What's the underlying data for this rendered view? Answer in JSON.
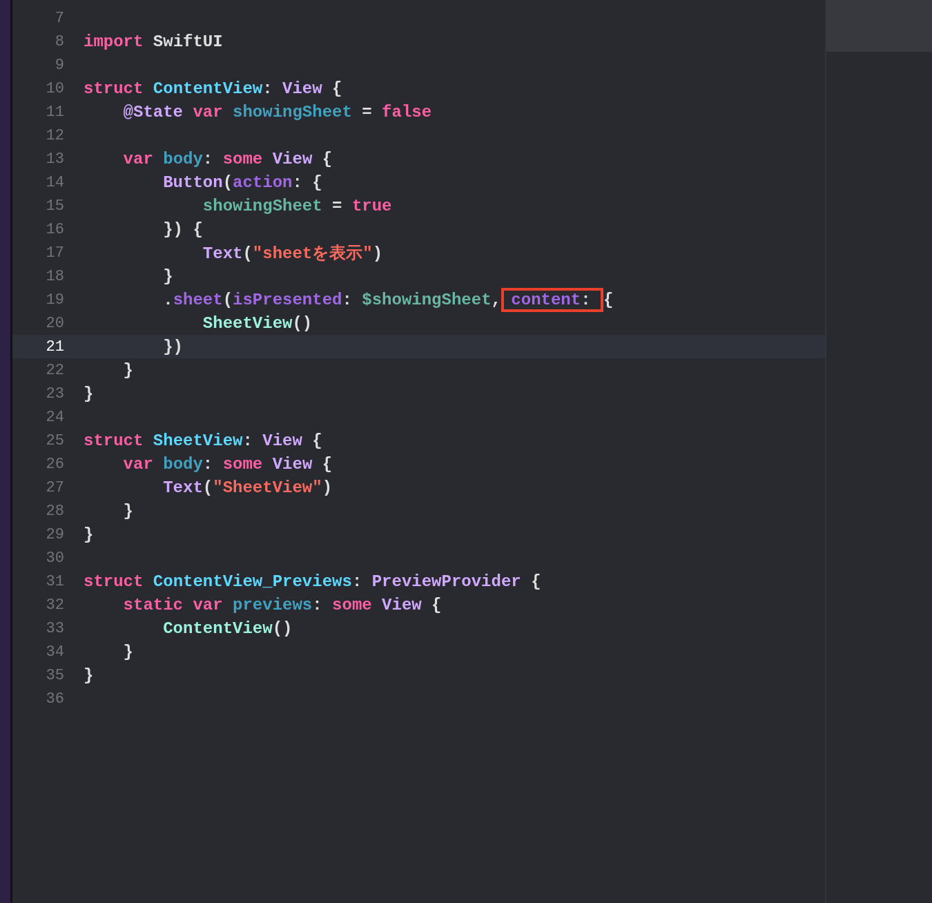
{
  "editor": {
    "lines": [
      {
        "number": "7",
        "current": false
      },
      {
        "number": "8",
        "current": false,
        "tokens": [
          {
            "text": "import",
            "kind": "keyword"
          },
          {
            "text": " SwiftUI",
            "kind": "plain"
          }
        ]
      },
      {
        "number": "9",
        "current": false
      },
      {
        "number": "10",
        "current": false,
        "tokens": [
          {
            "text": "struct",
            "kind": "keyword"
          },
          {
            "text": " ContentView",
            "kind": "decl"
          },
          {
            "text": ": ",
            "kind": "plain"
          },
          {
            "text": "View",
            "kind": "sdk"
          },
          {
            "text": " {",
            "kind": "plain"
          }
        ]
      },
      {
        "number": "11",
        "current": false,
        "tokens": [
          {
            "text": "    @State",
            "kind": "sdk"
          },
          {
            "text": " var",
            "kind": "keyword"
          },
          {
            "text": " showingSheet",
            "kind": "declvar"
          },
          {
            "text": " = ",
            "kind": "plain"
          },
          {
            "text": "false",
            "kind": "keyword"
          }
        ]
      },
      {
        "number": "12",
        "current": false
      },
      {
        "number": "13",
        "current": false,
        "tokens": [
          {
            "text": "    var",
            "kind": "keyword"
          },
          {
            "text": " body",
            "kind": "declvar"
          },
          {
            "text": ": ",
            "kind": "plain"
          },
          {
            "text": "some",
            "kind": "keyword"
          },
          {
            "text": " View",
            "kind": "sdk"
          },
          {
            "text": " {",
            "kind": "plain"
          }
        ]
      },
      {
        "number": "14",
        "current": false,
        "tokens": [
          {
            "text": "        Button",
            "kind": "sdk"
          },
          {
            "text": "(",
            "kind": "plain"
          },
          {
            "text": "action",
            "kind": "param"
          },
          {
            "text": ": {",
            "kind": "plain"
          }
        ]
      },
      {
        "number": "15",
        "current": false,
        "tokens": [
          {
            "text": "            showingSheet",
            "kind": "ref"
          },
          {
            "text": " = ",
            "kind": "plain"
          },
          {
            "text": "true",
            "kind": "keyword"
          }
        ]
      },
      {
        "number": "16",
        "current": false,
        "tokens": [
          {
            "text": "        }) {",
            "kind": "plain"
          }
        ]
      },
      {
        "number": "17",
        "current": false,
        "tokens": [
          {
            "text": "            Text",
            "kind": "sdk"
          },
          {
            "text": "(",
            "kind": "plain"
          },
          {
            "text": "\"sheetを表示\"",
            "kind": "string"
          },
          {
            "text": ")",
            "kind": "plain"
          }
        ]
      },
      {
        "number": "18",
        "current": false,
        "tokens": [
          {
            "text": "        }",
            "kind": "plain"
          }
        ]
      },
      {
        "number": "19",
        "current": false,
        "tokens": [
          {
            "text": "        .",
            "kind": "plain"
          },
          {
            "text": "sheet",
            "kind": "param"
          },
          {
            "text": "(",
            "kind": "plain"
          },
          {
            "text": "isPresented",
            "kind": "param"
          },
          {
            "text": ": ",
            "kind": "plain"
          },
          {
            "text": "$showingSheet",
            "kind": "ref"
          },
          {
            "text": ", ",
            "kind": "plain"
          },
          {
            "kind": "boxed",
            "tokens": [
              {
                "text": "content",
                "kind": "param"
              },
              {
                "text": ": ",
                "kind": "plain"
              }
            ]
          },
          {
            "text": "{",
            "kind": "plain"
          }
        ]
      },
      {
        "number": "20",
        "current": false,
        "tokens": [
          {
            "text": "            SheetView",
            "kind": "project"
          },
          {
            "text": "()",
            "kind": "plain"
          }
        ]
      },
      {
        "number": "21",
        "current": true,
        "tokens": [
          {
            "text": "        })",
            "kind": "plain"
          }
        ]
      },
      {
        "number": "22",
        "current": false,
        "tokens": [
          {
            "text": "    }",
            "kind": "plain"
          }
        ]
      },
      {
        "number": "23",
        "current": false,
        "tokens": [
          {
            "text": "}",
            "kind": "plain"
          }
        ]
      },
      {
        "number": "24",
        "current": false
      },
      {
        "number": "25",
        "current": false,
        "tokens": [
          {
            "text": "struct",
            "kind": "keyword"
          },
          {
            "text": " SheetView",
            "kind": "decl"
          },
          {
            "text": ": ",
            "kind": "plain"
          },
          {
            "text": "View",
            "kind": "sdk"
          },
          {
            "text": " {",
            "kind": "plain"
          }
        ]
      },
      {
        "number": "26",
        "current": false,
        "tokens": [
          {
            "text": "    var",
            "kind": "keyword"
          },
          {
            "text": " body",
            "kind": "declvar"
          },
          {
            "text": ": ",
            "kind": "plain"
          },
          {
            "text": "some",
            "kind": "keyword"
          },
          {
            "text": " View",
            "kind": "sdk"
          },
          {
            "text": " {",
            "kind": "plain"
          }
        ]
      },
      {
        "number": "27",
        "current": false,
        "tokens": [
          {
            "text": "        Text",
            "kind": "sdk"
          },
          {
            "text": "(",
            "kind": "plain"
          },
          {
            "text": "\"SheetView\"",
            "kind": "string"
          },
          {
            "text": ")",
            "kind": "plain"
          }
        ]
      },
      {
        "number": "28",
        "current": false,
        "tokens": [
          {
            "text": "    }",
            "kind": "plain"
          }
        ]
      },
      {
        "number": "29",
        "current": false,
        "tokens": [
          {
            "text": "}",
            "kind": "plain"
          }
        ]
      },
      {
        "number": "30",
        "current": false
      },
      {
        "number": "31",
        "current": false,
        "tokens": [
          {
            "text": "struct",
            "kind": "keyword"
          },
          {
            "text": " ContentView_Previews",
            "kind": "decl"
          },
          {
            "text": ": ",
            "kind": "plain"
          },
          {
            "text": "PreviewProvider",
            "kind": "sdk"
          },
          {
            "text": " {",
            "kind": "plain"
          }
        ]
      },
      {
        "number": "32",
        "current": false,
        "tokens": [
          {
            "text": "    static",
            "kind": "keyword"
          },
          {
            "text": " var",
            "kind": "keyword"
          },
          {
            "text": " previews",
            "kind": "declvar"
          },
          {
            "text": ": ",
            "kind": "plain"
          },
          {
            "text": "some",
            "kind": "keyword"
          },
          {
            "text": " View",
            "kind": "sdk"
          },
          {
            "text": " {",
            "kind": "plain"
          }
        ]
      },
      {
        "number": "33",
        "current": false,
        "tokens": [
          {
            "text": "        ContentView",
            "kind": "project"
          },
          {
            "text": "()",
            "kind": "plain"
          }
        ]
      },
      {
        "number": "34",
        "current": false,
        "tokens": [
          {
            "text": "    }",
            "kind": "plain"
          }
        ]
      },
      {
        "number": "35",
        "current": false,
        "tokens": [
          {
            "text": "}",
            "kind": "plain"
          }
        ]
      },
      {
        "number": "36",
        "current": false
      }
    ]
  }
}
